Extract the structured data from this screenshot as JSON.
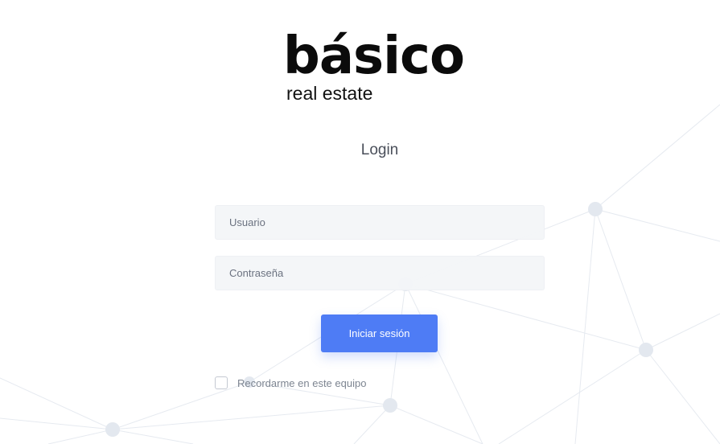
{
  "brand": {
    "name": "básico",
    "tagline": "real estate"
  },
  "login": {
    "title": "Login",
    "username_placeholder": "Usuario",
    "password_placeholder": "Contraseña",
    "submit_label": "Iniciar sesión",
    "remember_label": "Recordarme en este equipo",
    "remember_checked": false
  },
  "colors": {
    "primary_button": "#4e7cf5",
    "logo_text": "#0b0b0b",
    "field_background": "#f3f5f8",
    "network_lines": "#e6eaf0",
    "network_nodes": "#e3e8ef"
  },
  "background": {
    "pattern": "network-lines-and-nodes"
  }
}
